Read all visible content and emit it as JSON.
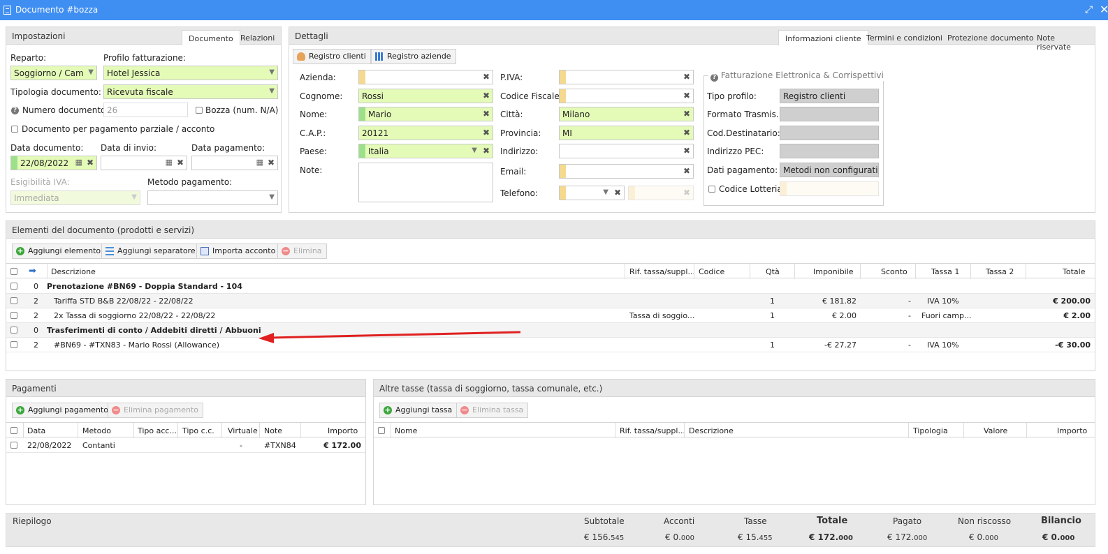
{
  "window": {
    "title": "Documento #bozza"
  },
  "impostazioni": {
    "title": "Impostazioni",
    "tabs": [
      "Documento",
      "Relazioni"
    ],
    "reparto_label": "Reparto:",
    "reparto_value": "Soggiorno / Camera",
    "profilo_label": "Profilo fatturazione:",
    "profilo_value": "Hotel Jessica",
    "tipologia_label": "Tipologia documento:",
    "tipologia_value": "Ricevuta fiscale",
    "numero_label": "Numero documento:",
    "numero_value": "26",
    "bozza_label": "Bozza (num. N/A)",
    "parziale_label": "Documento per pagamento parziale / acconto",
    "data_doc_label": "Data documento:",
    "data_doc_value": "22/08/2022",
    "data_invio_label": "Data di invio:",
    "data_pag_label": "Data pagamento:",
    "esig_label": "Esigibilità IVA:",
    "esig_value": "Immediata",
    "metodo_label": "Metodo pagamento:"
  },
  "dettagli": {
    "title": "Dettagli",
    "tabs": [
      "Informazioni cliente",
      "Termini e condizioni",
      "Protezione documento",
      "Note riservate"
    ],
    "btn_clienti": "Registro clienti",
    "btn_aziende": "Registro aziende",
    "azienda_label": "Azienda:",
    "cognome_label": "Cognome:",
    "cognome_value": "Rossi",
    "nome_label": "Nome:",
    "nome_value": "Mario",
    "cap_label": "C.A.P.:",
    "cap_value": "20121",
    "paese_label": "Paese:",
    "paese_value": "Italia",
    "note_label": "Note:",
    "piva_label": "P.IVA:",
    "cf_label": "Codice Fiscale:",
    "citta_label": "Città:",
    "citta_value": "Milano",
    "provincia_label": "Provincia:",
    "provincia_value": "MI",
    "indirizzo_label": "Indirizzo:",
    "email_label": "Email:",
    "telefono_label": "Telefono:",
    "fe_title": "Fatturazione Elettronica & Corrispettivi",
    "tipo_profilo_label": "Tipo profilo:",
    "tipo_profilo_value": "Registro clienti",
    "formato_label": "Formato Trasmis.:",
    "coddest_label": "Cod.Destinatario:",
    "pec_label": "Indirizzo PEC:",
    "datipag_label": "Dati pagamento:",
    "datipag_value": "Metodi non configurati",
    "lotteria_label": "Codice Lotteria:"
  },
  "elementi": {
    "title": "Elementi del documento (prodotti e servizi)",
    "buttons": {
      "add": "Aggiungi elemento",
      "sep": "Aggiungi separatore",
      "import": "Importa acconto",
      "del": "Elimina"
    },
    "columns": {
      "descrizione": "Descrizione",
      "rif": "Rif. tassa/suppl...",
      "codice": "Codice",
      "qta": "Qtà",
      "imponibile": "Imponibile",
      "sconto": "Sconto",
      "tassa1": "Tassa 1",
      "tassa2": "Tassa 2",
      "totale": "Totale"
    },
    "rows": [
      {
        "level": "0",
        "descrizione": "Prenotazione #BN69 - Doppia Standard - 104",
        "rif": "",
        "qta": "",
        "imponibile": "",
        "sconto": "",
        "tassa1": "",
        "totale": "",
        "group": true
      },
      {
        "level": "2",
        "descrizione": "Tariffa STD B&B 22/08/22 - 22/08/22",
        "rif": "",
        "qta": "1",
        "imponibile": "€ 181.82",
        "sconto": "-",
        "tassa1": "IVA 10%",
        "totale": "€ 200.00",
        "group": false
      },
      {
        "level": "2",
        "descrizione": "2x Tassa di soggiorno 22/08/22 - 22/08/22",
        "rif": "Tassa di soggio...",
        "qta": "1",
        "imponibile": "€ 2.00",
        "sconto": "-",
        "tassa1": "Fuori camp...",
        "totale": "€ 2.00",
        "group": false
      },
      {
        "level": "0",
        "descrizione": "Trasferimenti di conto / Addebiti diretti / Abbuoni",
        "rif": "",
        "qta": "",
        "imponibile": "",
        "sconto": "",
        "tassa1": "",
        "totale": "",
        "group": true
      },
      {
        "level": "2",
        "descrizione": "#BN69 - #TXN83 - Mario Rossi (Allowance)",
        "rif": "",
        "qta": "1",
        "imponibile": "-€ 27.27",
        "sconto": "-",
        "tassa1": "IVA 10%",
        "totale": "-€ 30.00",
        "group": false
      }
    ]
  },
  "pagamenti": {
    "title": "Pagamenti",
    "btn_add": "Aggiungi pagamento",
    "btn_del": "Elimina pagamento",
    "columns": {
      "data": "Data",
      "metodo": "Metodo",
      "tipo_acc": "Tipo acc...",
      "tipo_cc": "Tipo c.c.",
      "virtuale": "Virtuale",
      "note": "Note",
      "importo": "Importo"
    },
    "rows": [
      {
        "data": "22/08/2022",
        "metodo": "Contanti",
        "virtuale": "-",
        "note": "#TXN84",
        "importo": "€ 172.00"
      }
    ]
  },
  "altre_tasse": {
    "title": "Altre tasse (tassa di soggiorno, tassa comunale, etc.)",
    "btn_add": "Aggiungi tassa",
    "btn_del": "Elimina tassa",
    "columns": {
      "nome": "Nome",
      "rif": "Rif. tassa/suppl...",
      "descrizione": "Descrizione",
      "tipologia": "Tipologia",
      "valore": "Valore",
      "importo": "Importo"
    }
  },
  "riepilogo": {
    "title": "Riepilogo",
    "subtotale_label": "Subtotale",
    "subtotale_int": "€ 156.",
    "subtotale_dec": "545",
    "acconti_label": "Acconti",
    "acconti_int": "€ 0.",
    "acconti_dec": "000",
    "tasse_label": "Tasse",
    "tasse_int": "€ 15.",
    "tasse_dec": "455",
    "totale_label": "Totale",
    "totale_int": "€ 172.",
    "totale_dec": "000",
    "pagato_label": "Pagato",
    "pagato_int": "€ 172.",
    "pagato_dec": "000",
    "nonriscosso_label": "Non riscosso",
    "nonriscosso_int": "€ 0.",
    "nonriscosso_dec": "000",
    "bilancio_label": "Bilancio",
    "bilancio_int": "€ 0.",
    "bilancio_dec": "000"
  },
  "colors": {
    "titlebar": "#3f8ef2",
    "required_field": "#e4fbb8",
    "annotation_arrow": "#e02020"
  }
}
